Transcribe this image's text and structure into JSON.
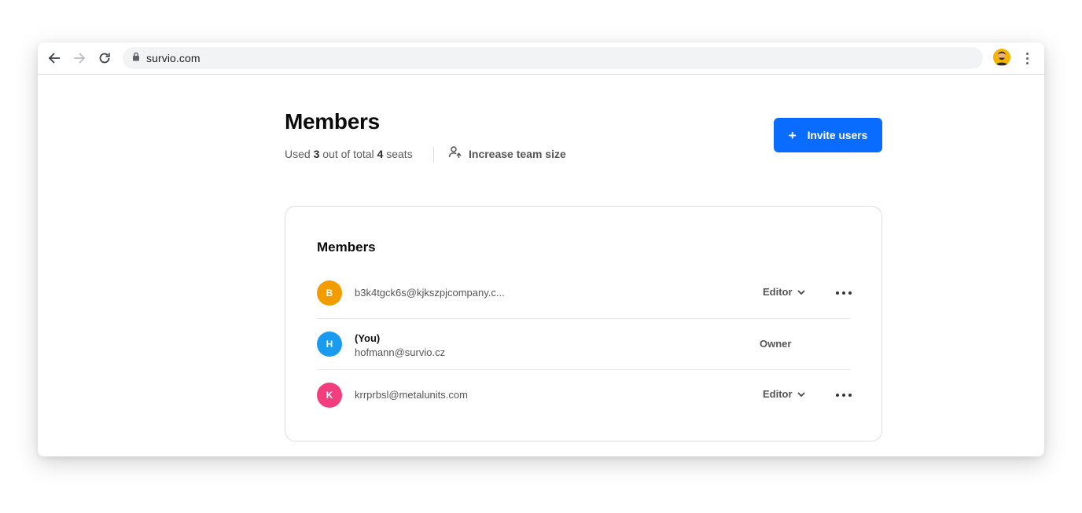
{
  "browser": {
    "url": "survio.com"
  },
  "header": {
    "title": "Members",
    "seats_prefix": "Used ",
    "seats_used": "3",
    "seats_mid": " out of total ",
    "seats_total": "4",
    "seats_suffix": " seats",
    "increase_label": "Increase team size",
    "invite_plus": "+",
    "invite_label": "Invite users"
  },
  "members_card": {
    "title": "Members",
    "rows": [
      {
        "initial": "B",
        "avatar_color": "#f29c00",
        "email": "b3k4tgck6s@kjkszpjcompany.c...",
        "role": "Editor"
      },
      {
        "initial": "H",
        "avatar_color": "#1a9bf0",
        "name": "(You)",
        "email": "hofmann@survio.cz",
        "role": "Owner"
      },
      {
        "initial": "K",
        "avatar_color": "#f23d7e",
        "email": "krrprbsl@metalunits.com",
        "role": "Editor"
      }
    ]
  },
  "colors": {
    "accent": "#0a6cff"
  }
}
